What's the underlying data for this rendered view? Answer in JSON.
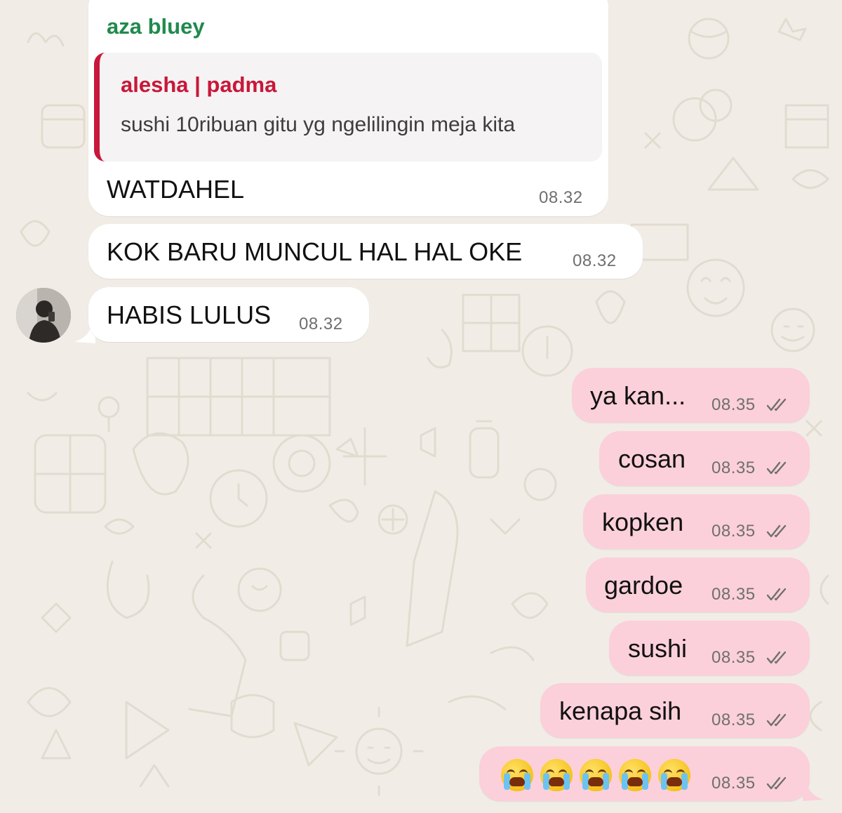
{
  "colors": {
    "wallpaper": "#f1ede6",
    "incoming_bubble": "#ffffff",
    "outgoing_bubble": "#fbd0da",
    "sender_name": "#1f8a4c",
    "quote_author": "#c8173a",
    "quote_bar": "#c8173a",
    "time_text": "#6f6f6f"
  },
  "incoming": {
    "sender": "aza bluey",
    "quote": {
      "author": "alesha | padma",
      "text": "sushi 10ribuan gitu yg ngelilingin meja kita"
    },
    "messages": [
      {
        "text": "WATDAHEL",
        "time": "08.32"
      },
      {
        "text": "KOK BARU MUNCUL HAL HAL OKE",
        "time": "08.32"
      },
      {
        "text": "HABIS LULUS",
        "time": "08.32"
      }
    ],
    "avatar_icon": "profile-photo"
  },
  "outgoing": {
    "status_icon": "double-check-icon",
    "messages": [
      {
        "text": "ya kan...",
        "time": "08.35"
      },
      {
        "text": "cosan",
        "time": "08.35"
      },
      {
        "text": "kopken",
        "time": "08.35"
      },
      {
        "text": "gardoe",
        "time": "08.35"
      },
      {
        "text": "sushi",
        "time": "08.35"
      },
      {
        "text": "kenapa sih",
        "time": "08.35"
      },
      {
        "text": "",
        "emoji_icon": "loudly-crying-face-icon",
        "emoji_count": 5,
        "time": "08.35"
      }
    ]
  }
}
